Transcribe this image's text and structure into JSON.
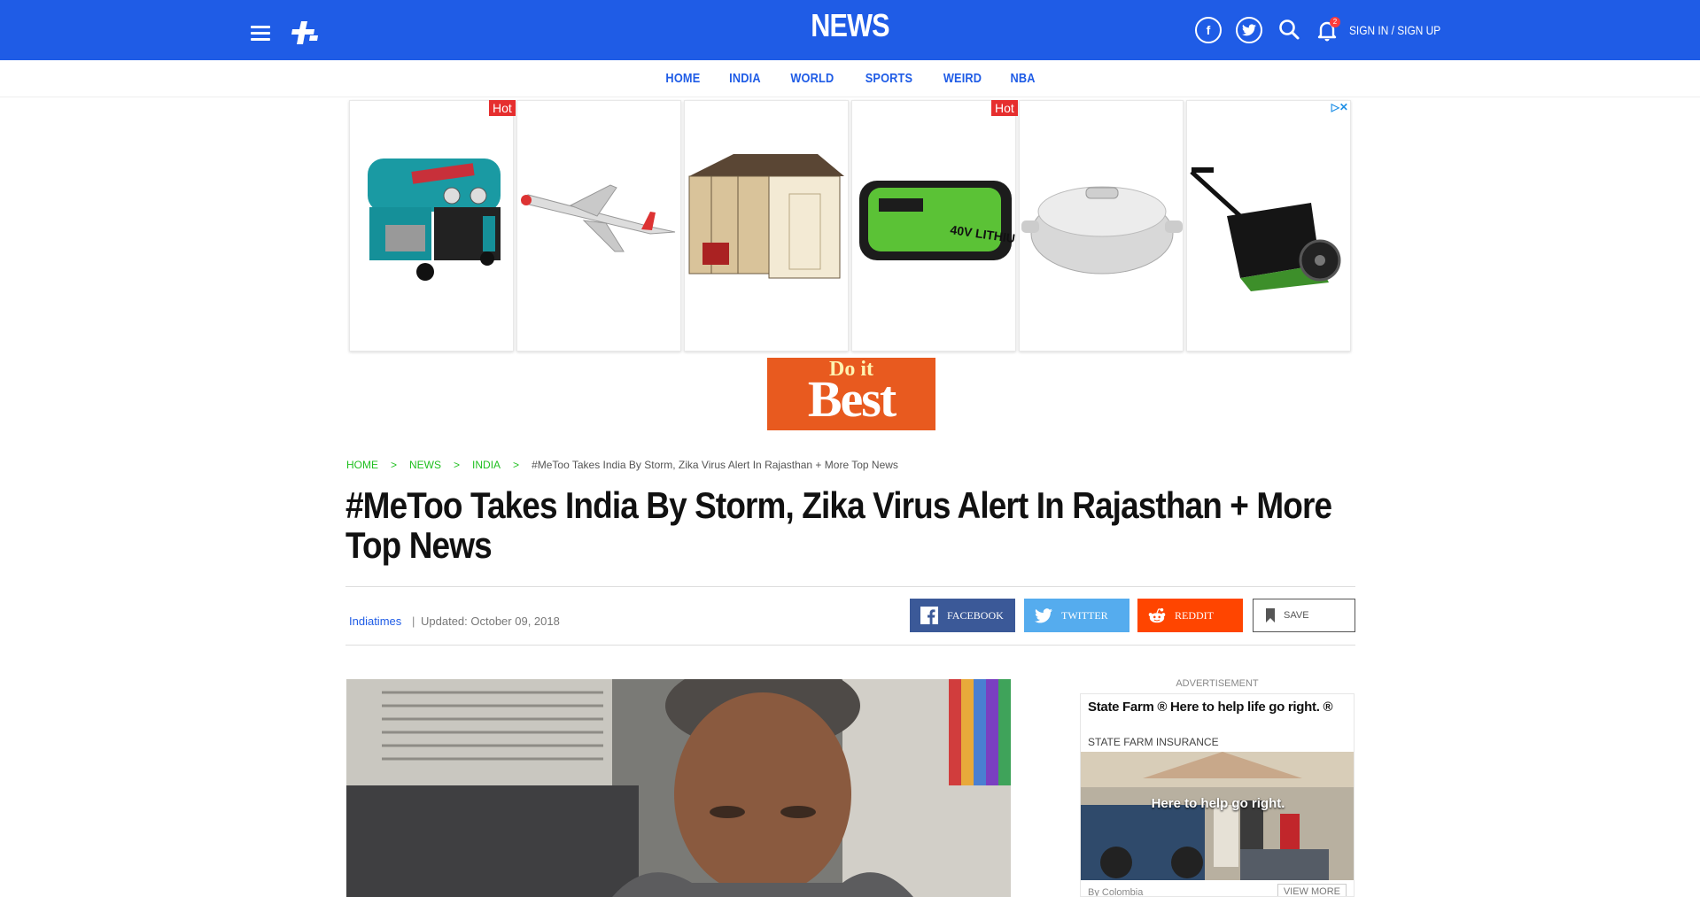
{
  "header": {
    "brand": "NEWS",
    "sign_in": "SIGN IN",
    "sign_sep": "/",
    "sign_up": "SIGN UP",
    "notification_count": "2",
    "facebook_glyph": "f"
  },
  "nav": [
    "HOME",
    "INDIA",
    "WORLD",
    "SPORTS",
    "WEIRD",
    "NBA"
  ],
  "ads": {
    "hot_label": "Hot",
    "adchoices_label": "▷✕",
    "banner_top": "Do it",
    "banner_bottom": "Best",
    "tiles": [
      {
        "product": "air-compressor",
        "hot": false
      },
      {
        "product": "toy-glider-plane",
        "hot": true
      },
      {
        "product": "storage-shed",
        "hot": false
      },
      {
        "product": "lithium-battery",
        "hot": true
      },
      {
        "product": "roaster-pot",
        "hot": false
      },
      {
        "product": "lawn-sweeper",
        "hot": false
      }
    ]
  },
  "breadcrumb": {
    "home": "HOME",
    "news": "NEWS",
    "india": "INDIA",
    "sep": ">",
    "current": "#MeToo Takes India By Storm, Zika Virus Alert In Rajasthan + More Top News"
  },
  "article": {
    "headline": "#MeToo Takes India By Storm, Zika Virus Alert In Rajasthan + More Top News",
    "author": "Indiatimes",
    "divider": "|",
    "updated": "Updated: October 09, 2018"
  },
  "share": {
    "facebook": "FACEBOOK",
    "twitter": "TWITTER",
    "reddit": "REDDIT",
    "save": "SAVE"
  },
  "sidebar_ad": {
    "label": "ADVERTISEMENT",
    "title": "State Farm ® Here to help life go right. ®",
    "sponsor": "STATE FARM INSURANCE",
    "caption": "Here to help      go right.",
    "footer": "By Colombia",
    "view_more": "VIEW MORE"
  },
  "colors": {
    "brand_blue": "#1f5ce6",
    "breadcrumb_green": "#1fbf1f",
    "facebook": "#3b5998",
    "twitter": "#55acee",
    "reddit": "#ff4500"
  }
}
